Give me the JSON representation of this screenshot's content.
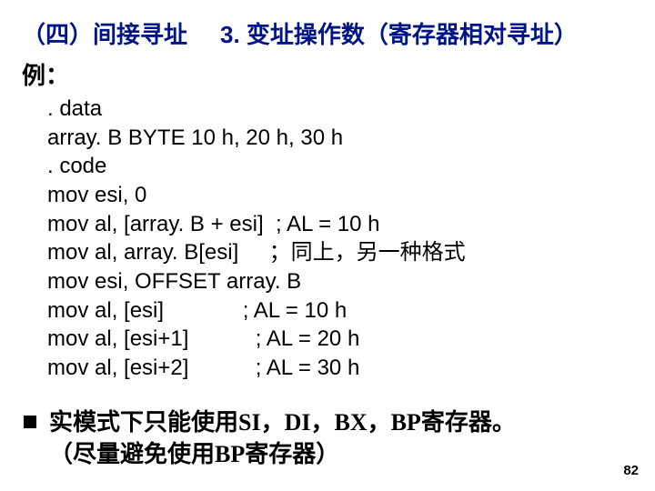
{
  "title": {
    "left": "（四）间接寻址",
    "right": "3. 变址操作数（寄存器相对寻址）"
  },
  "example_label": "例：",
  "code": {
    "l1": ". data",
    "l2": "array. B BYTE 10 h, 20 h, 30 h",
    "l3": ". code",
    "l4": "mov esi, 0",
    "l5": "mov al, [array. B + esi]  ; AL = 10 h",
    "l6": "mov al, array. B[esi]     ；同上，另一种格式",
    "l7": "mov esi, OFFSET array. B",
    "l8": "mov al, [esi]             ; AL = 10 h",
    "l9": "mov al, [esi+1]           ; AL = 20 h",
    "l10": "mov al, [esi+2]           ; AL = 30 h"
  },
  "note": {
    "line1": "实模式下只能使用SI，DI，BX，BP寄存器。",
    "line2": "（尽量避免使用BP寄存器）"
  },
  "page_number": "82"
}
